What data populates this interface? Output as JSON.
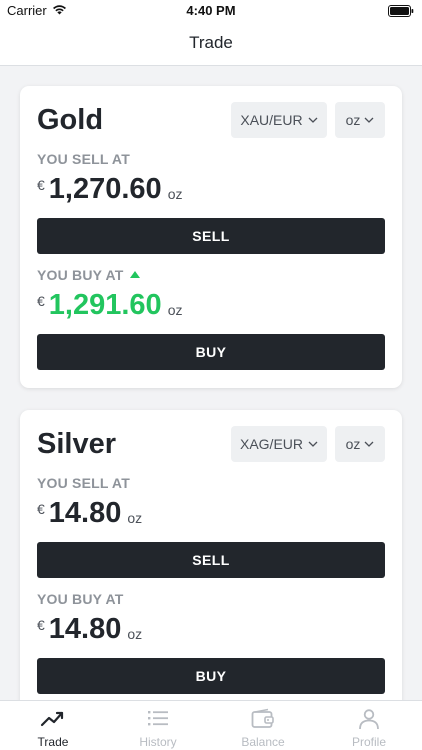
{
  "status_bar": {
    "carrier": "Carrier",
    "time": "4:40 PM"
  },
  "header": {
    "title": "Trade"
  },
  "colors": {
    "accent_dark": "#22262c",
    "up_green": "#22c55e",
    "label_gray": "#8e939a"
  },
  "cards": [
    {
      "metal": "Gold",
      "pair": "XAU/EUR",
      "unit_select": "oz",
      "sell_label": "YOU SELL AT",
      "sell_currency": "€",
      "sell_price": "1,270.60",
      "sell_unit": "oz",
      "sell_button": "SELL",
      "buy_label": "YOU BUY AT",
      "buy_currency": "€",
      "buy_price": "1,291.60",
      "buy_unit": "oz",
      "buy_trend": "up-arrow-icon",
      "buy_button": "BUY"
    },
    {
      "metal": "Silver",
      "pair": "XAG/EUR",
      "unit_select": "oz",
      "sell_label": "YOU SELL AT",
      "sell_currency": "€",
      "sell_price": "14.80",
      "sell_unit": "oz",
      "sell_button": "SELL",
      "buy_label": "YOU BUY AT",
      "buy_currency": "€",
      "buy_price": "14.80",
      "buy_unit": "oz",
      "buy_button": "BUY"
    }
  ],
  "tabs": [
    {
      "label": "Trade",
      "icon": "trend-chart-icon",
      "active": true
    },
    {
      "label": "History",
      "icon": "list-icon",
      "active": false
    },
    {
      "label": "Balance",
      "icon": "wallet-icon",
      "active": false
    },
    {
      "label": "Profile",
      "icon": "person-icon",
      "active": false
    }
  ]
}
